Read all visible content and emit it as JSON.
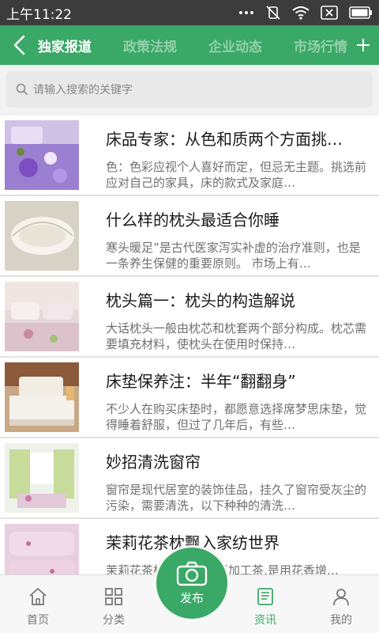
{
  "status_bar": {
    "time": "上午11:22",
    "icons": [
      "signal-dots-icon",
      "mute-icon",
      "wifi-icon",
      "close-box-icon",
      "battery-icon"
    ]
  },
  "nav": {
    "tabs": [
      {
        "label": "独家报道",
        "active": true
      },
      {
        "label": "政策法规",
        "active": false
      },
      {
        "label": "企业动态",
        "active": false
      },
      {
        "label": "市场行情",
        "active": false
      }
    ]
  },
  "search": {
    "placeholder": "请输入搜索的关键字"
  },
  "articles": [
    {
      "title": "床品专家：从色和质两个方面挑…",
      "desc": "色：色彩应视个人喜好而定，但忌无主题。挑选前应对自己的家具，床的款式及家庭…"
    },
    {
      "title": "什么样的枕头最适合你睡",
      "desc": "寒头暖足”是古代医家泻实补虚的治疗准则，也是一条养生保健的重要原则。 市场上有…"
    },
    {
      "title": "枕头篇一：枕头的构造解说",
      "desc": "大话枕头一般由枕芯和枕套两个部分构成。枕芯需要填充材料，使枕头在使用时保持…"
    },
    {
      "title": "床垫保养注：半年“翻翻身”",
      "desc": "不少人在购买床垫时，都愿意选择席梦思床垫，觉得睡着舒服，但过了几年后，有些…"
    },
    {
      "title": "妙招清洗窗帘",
      "desc": "窗帘是现代居室的装饰佳品，挂久了窗帘受灰尘的污染，需要清洗，以下种种的清洗…"
    },
    {
      "title": "茉莉花茶枕飘入家纺世界",
      "desc": "茉莉花茶枕:茉莉花属再加工茶,是用花香增…"
    }
  ],
  "bottom_nav": {
    "items": [
      {
        "label": "首页",
        "icon": "home-icon"
      },
      {
        "label": "分类",
        "icon": "grid-icon"
      },
      {
        "label": "资讯",
        "icon": "news-icon",
        "active": true
      },
      {
        "label": "我的",
        "icon": "user-icon"
      }
    ],
    "publish_label": "发布"
  },
  "colors": {
    "accent": "#3aa866",
    "status_bar": "#3c3c3c"
  }
}
